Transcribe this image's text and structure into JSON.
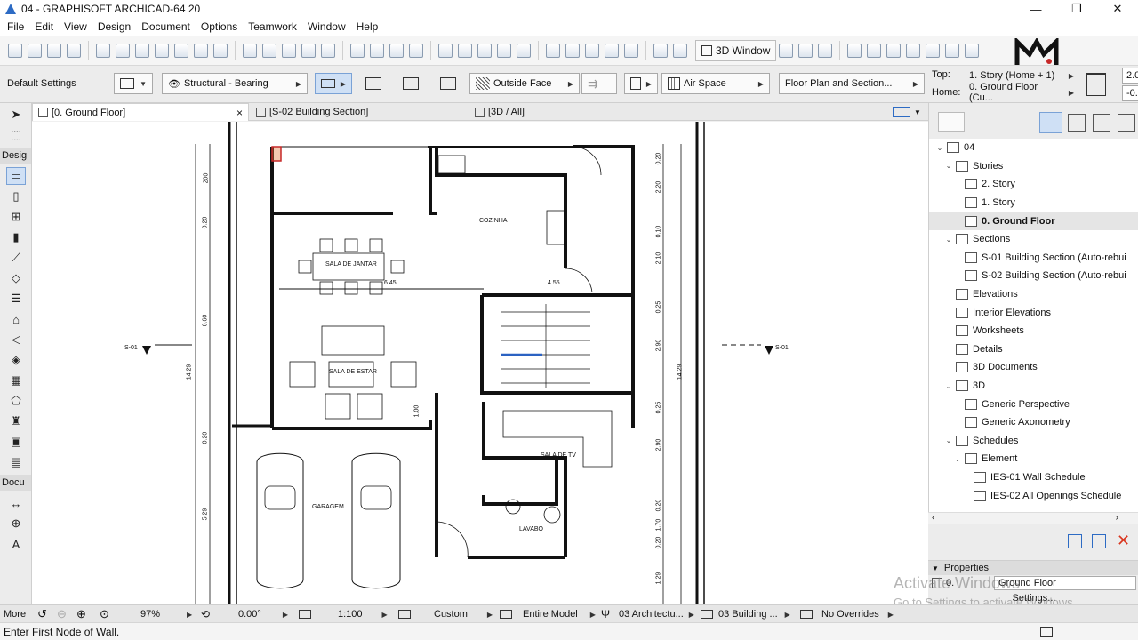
{
  "window": {
    "title": "04 - GRAPHISOFT ARCHICAD-64 20",
    "controls": [
      "—",
      "❐",
      "✕"
    ]
  },
  "menu": [
    "File",
    "Edit",
    "View",
    "Design",
    "Document",
    "Options",
    "Teamwork",
    "Window",
    "Help"
  ],
  "toolbar": {
    "view_3d_label": "3D Window"
  },
  "infobox": {
    "default_settings": "Default Settings",
    "structure": "Structural - Bearing",
    "reference_line": "Outside Face",
    "composite": "Air Space",
    "view_set": "Floor Plan and Section...",
    "top_label": "Top:",
    "top_value": "1. Story (Home + 1)",
    "home_label": "Home:",
    "home_value": "0. Ground Floor (Cu...",
    "height_top": "2.0",
    "height_bottom": "-0."
  },
  "tabs": [
    {
      "label": "[0. Ground Floor]",
      "close": "×"
    },
    {
      "label": "[S-02 Building Section]"
    },
    {
      "label": "[3D / All]"
    }
  ],
  "toolbox": {
    "design_label": "Desig",
    "document_label": "Docu",
    "more_label": "More"
  },
  "navigator": {
    "items": [
      {
        "label": "04",
        "level": 0,
        "toggle": "⌄"
      },
      {
        "label": "Stories",
        "level": 1,
        "toggle": "⌄"
      },
      {
        "label": "2. Story",
        "level": 2,
        "toggle": ""
      },
      {
        "label": "1. Story",
        "level": 2,
        "toggle": ""
      },
      {
        "label": "0. Ground Floor",
        "level": 2,
        "toggle": "",
        "selected": true
      },
      {
        "label": "Sections",
        "level": 1,
        "toggle": "⌄"
      },
      {
        "label": "S-01 Building Section (Auto-rebui",
        "level": 2,
        "toggle": ""
      },
      {
        "label": "S-02 Building Section (Auto-rebui",
        "level": 2,
        "toggle": ""
      },
      {
        "label": "Elevations",
        "level": 1,
        "toggle": ""
      },
      {
        "label": "Interior Elevations",
        "level": 1,
        "toggle": ""
      },
      {
        "label": "Worksheets",
        "level": 1,
        "toggle": ""
      },
      {
        "label": "Details",
        "level": 1,
        "toggle": ""
      },
      {
        "label": "3D Documents",
        "level": 1,
        "toggle": ""
      },
      {
        "label": "3D",
        "level": 1,
        "toggle": "⌄"
      },
      {
        "label": "Generic Perspective",
        "level": 2,
        "toggle": ""
      },
      {
        "label": "Generic Axonometry",
        "level": 2,
        "toggle": ""
      },
      {
        "label": "Schedules",
        "level": 1,
        "toggle": "⌄"
      },
      {
        "label": "Element",
        "level": 2,
        "toggle": "⌄"
      },
      {
        "label": "IES-01 Wall Schedule",
        "level": 3,
        "toggle": ""
      },
      {
        "label": "IES-02 All Openings Schedule",
        "level": 3,
        "toggle": ""
      }
    ]
  },
  "properties": {
    "title": "Properties",
    "id": "0.",
    "name": "Ground Floor",
    "settings": "Settings..."
  },
  "statusbar": {
    "zoom": "97%",
    "angle": "0.00°",
    "scale": "1:100",
    "layer_combo": "Custom",
    "model_view": "Entire Model",
    "pen_set": "03 Architectu...",
    "dimension": "03 Building ...",
    "overrides": "No Overrides"
  },
  "hint": "Enter First Node of Wall.",
  "watermark": {
    "line1": "Activate Windows",
    "line2": "Go to Settings to activate Windows."
  },
  "plan": {
    "rooms": {
      "cozinha": "COZINHA",
      "sala_jantar": "SALA DE JANTAR",
      "sala_estar": "SALA DE ESTAR",
      "sala_tv": "SALA DE TV",
      "garagem": "GARAGEM",
      "lavabo": "LAVABO"
    },
    "dims_left": [
      "200",
      "0.20",
      "6.60",
      "0.20",
      "5.29"
    ],
    "dim_total_left": "14.29",
    "dims_right": [
      "0.20",
      "2.20",
      "0.10",
      "2.10",
      "0.25",
      "2.90",
      "0.25",
      "2.90",
      "0.20",
      "1.70",
      "0.20",
      "1.29"
    ],
    "dim_total_right": "14.29",
    "dims_mid": [
      "6.45",
      "4.55",
      "1.00"
    ],
    "section_left": "S-01",
    "section_right": "S-01"
  }
}
